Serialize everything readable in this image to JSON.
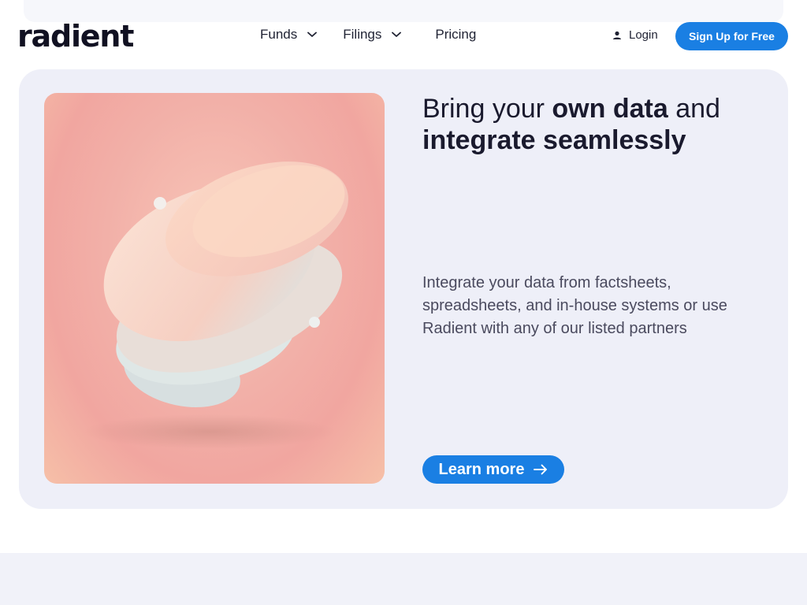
{
  "header": {
    "logo": "radient",
    "nav": [
      {
        "label": "Funds"
      },
      {
        "label": "Filings"
      },
      {
        "label": "Pricing"
      }
    ],
    "login_label": "Login",
    "signup_label": "Sign Up for Free"
  },
  "hero": {
    "headline_pre": "Bring your ",
    "headline_bold1": "own data",
    "headline_mid": " and",
    "headline_bold2": "integrate seamlessly",
    "description": "Integrate your data from factsheets, spreadsheets, and in-house systems or use Radient with any of our listed partners",
    "cta_label": "Learn more"
  },
  "icons": {
    "nav_chevron": "chevron-down-icon",
    "login": "user-icon",
    "cta": "arrow-right-icon"
  },
  "colors": {
    "brand": "#1a7fe3",
    "card_bg": "#eeeff8",
    "text": "#1a1a2e"
  }
}
